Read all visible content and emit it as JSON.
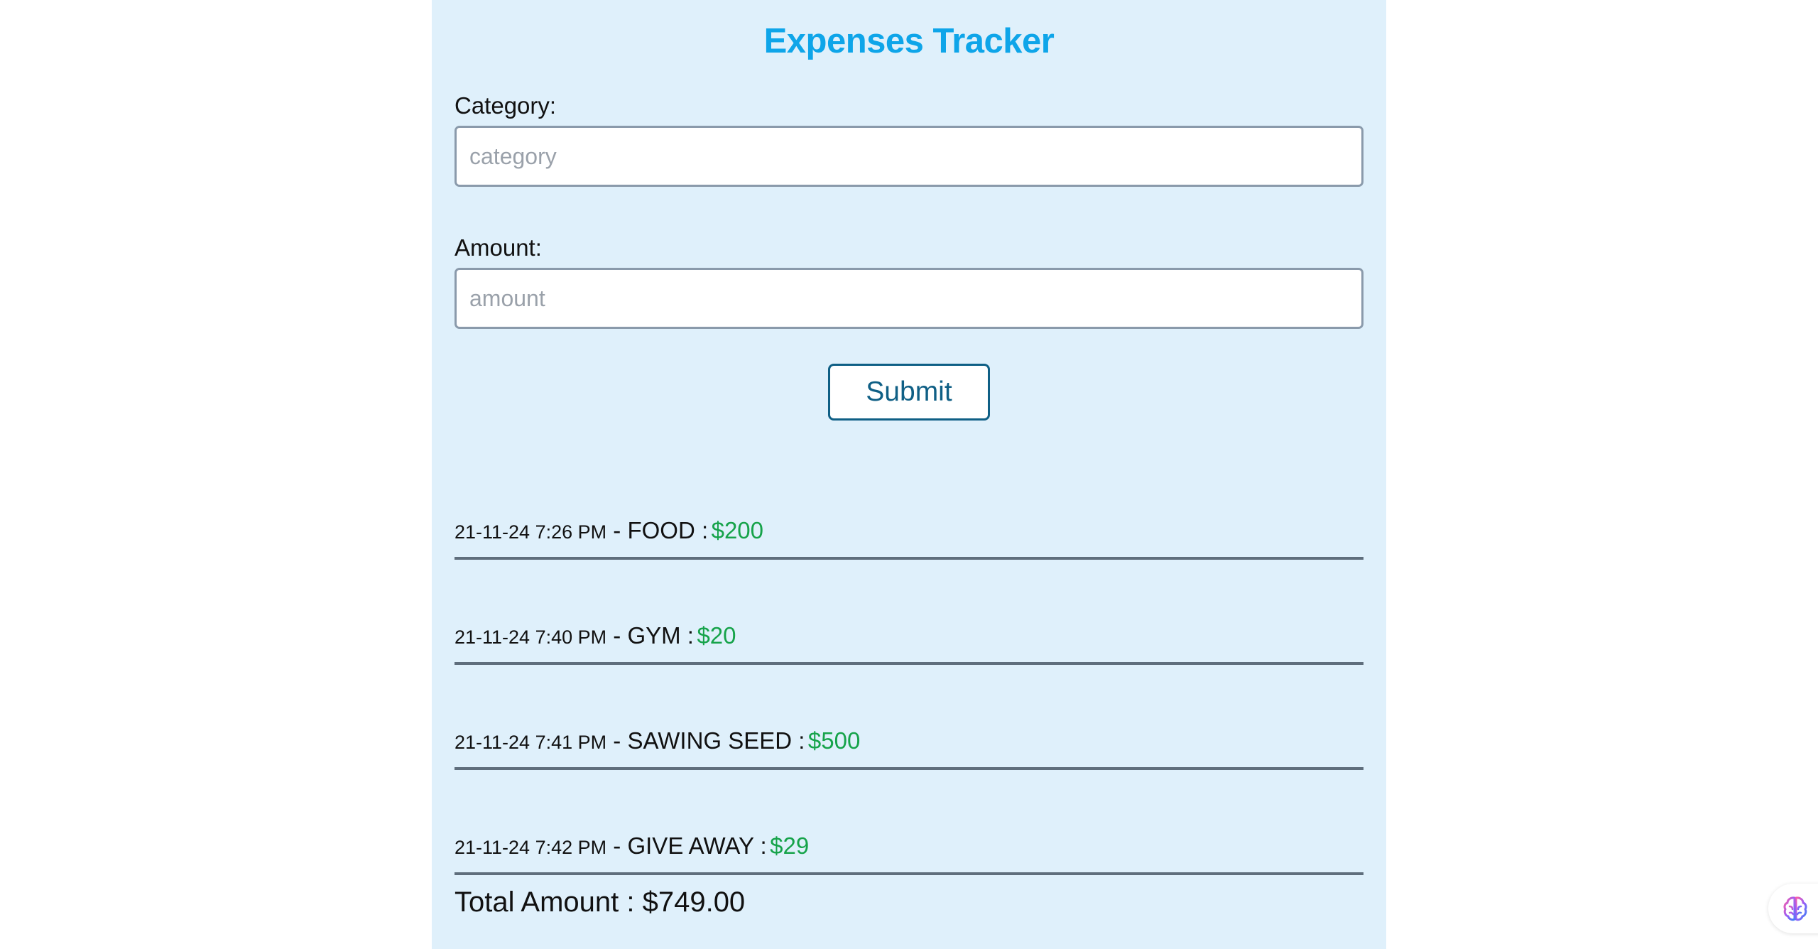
{
  "app": {
    "title": "Expenses Tracker"
  },
  "form": {
    "category": {
      "label": "Category:",
      "placeholder": "category",
      "value": ""
    },
    "amount": {
      "label": "Amount:",
      "placeholder": "amount",
      "value": ""
    },
    "submit_label": "Submit"
  },
  "expenses": [
    {
      "date": "21-11-24 7:26 PM",
      "separator": " - ",
      "category": "FOOD :",
      "amount": "$200"
    },
    {
      "date": "21-11-24 7:40 PM",
      "separator": " - ",
      "category": "GYM :",
      "amount": "$20"
    },
    {
      "date": "21-11-24 7:41 PM",
      "separator": " - ",
      "category": "SAWING SEED :",
      "amount": "$500"
    },
    {
      "date": "21-11-24 7:42 PM",
      "separator": " - ",
      "category": "GIVE AWAY :",
      "amount": "$29"
    }
  ],
  "total_label": "Total Amount : $749.00",
  "colors": {
    "panel_bg": "#dff0fb",
    "title": "#0ea5e9",
    "amount": "#16a34a",
    "button_border": "#0f5f85"
  },
  "icons": {
    "assistant": "brain-icon"
  }
}
